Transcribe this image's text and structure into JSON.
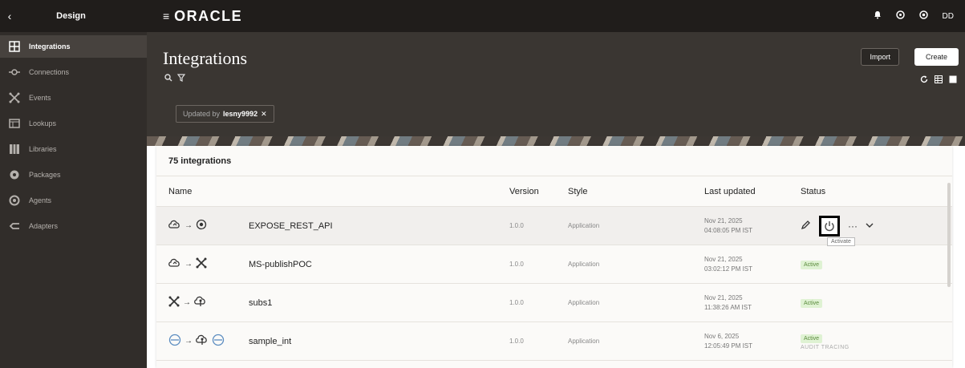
{
  "sidebar": {
    "title": "Design",
    "items": [
      {
        "label": "Integrations"
      },
      {
        "label": "Connections"
      },
      {
        "label": "Events"
      },
      {
        "label": "Lookups"
      },
      {
        "label": "Libraries"
      },
      {
        "label": "Packages"
      },
      {
        "label": "Agents"
      },
      {
        "label": "Adapters"
      }
    ]
  },
  "topbar": {
    "brand": "ORACLE",
    "user_initials": "DD"
  },
  "header": {
    "title": "Integrations",
    "filter_prefix": "Updated by",
    "filter_value": "lesny9992",
    "import_label": "Import",
    "create_label": "Create"
  },
  "table": {
    "count_label": "75 integrations",
    "columns": [
      "Name",
      "Version",
      "Style",
      "Last updated",
      "Status"
    ],
    "rows": [
      {
        "name": "EXPOSE_REST_API",
        "version": "1.0.0",
        "style": "Application",
        "updated_line1": "Nov 21, 2025",
        "updated_line2": "04:08:05 PM IST",
        "status": ""
      },
      {
        "name": "MS-publishPOC",
        "version": "1.0.0",
        "style": "Application",
        "updated_line1": "Nov 21, 2025",
        "updated_line2": "03:02:12 PM IST",
        "status": "Active"
      },
      {
        "name": "subs1",
        "version": "1.0.0",
        "style": "Application",
        "updated_line1": "Nov 21, 2025",
        "updated_line2": "11:38:26 AM IST",
        "status": "Active"
      },
      {
        "name": "sample_int",
        "version": "1.0.0",
        "style": "Application",
        "updated_line1": "Nov 6, 2025",
        "updated_line2": "12:05:49 PM IST",
        "status": "Active",
        "audit": "AUDIT TRACING"
      }
    ],
    "tooltip": "Activate"
  }
}
